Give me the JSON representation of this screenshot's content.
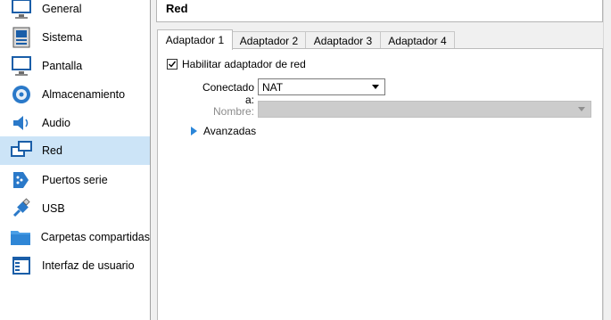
{
  "sidebar": {
    "items": [
      {
        "label": "General",
        "icon": "monitor-icon"
      },
      {
        "label": "Sistema",
        "icon": "chip-icon"
      },
      {
        "label": "Pantalla",
        "icon": "monitor-icon"
      },
      {
        "label": "Almacenamiento",
        "icon": "disk-icon"
      },
      {
        "label": "Audio",
        "icon": "speaker-icon"
      },
      {
        "label": "Red",
        "icon": "network-icon",
        "selected": true
      },
      {
        "label": "Puertos serie",
        "icon": "serial-port-icon"
      },
      {
        "label": "USB",
        "icon": "usb-icon"
      },
      {
        "label": "Carpetas compartidas",
        "icon": "folder-icon"
      },
      {
        "label": "Interfaz de usuario",
        "icon": "window-icon"
      }
    ]
  },
  "header": {
    "title": "Red"
  },
  "tabs": [
    {
      "label": "Adaptador 1",
      "active": true
    },
    {
      "label": "Adaptador 2",
      "active": false
    },
    {
      "label": "Adaptador 3",
      "active": false
    },
    {
      "label": "Adaptador 4",
      "active": false
    }
  ],
  "adapter": {
    "enable_label": "Habilitar adaptador de red",
    "enabled": true,
    "connected_label": "Conectado a:",
    "connected_value": "NAT",
    "name_label": "Nombre:",
    "name_value": "",
    "advanced_label": "Avanzadas"
  },
  "colors": {
    "selection": "#cce4f7",
    "accent": "#2b86d9"
  }
}
